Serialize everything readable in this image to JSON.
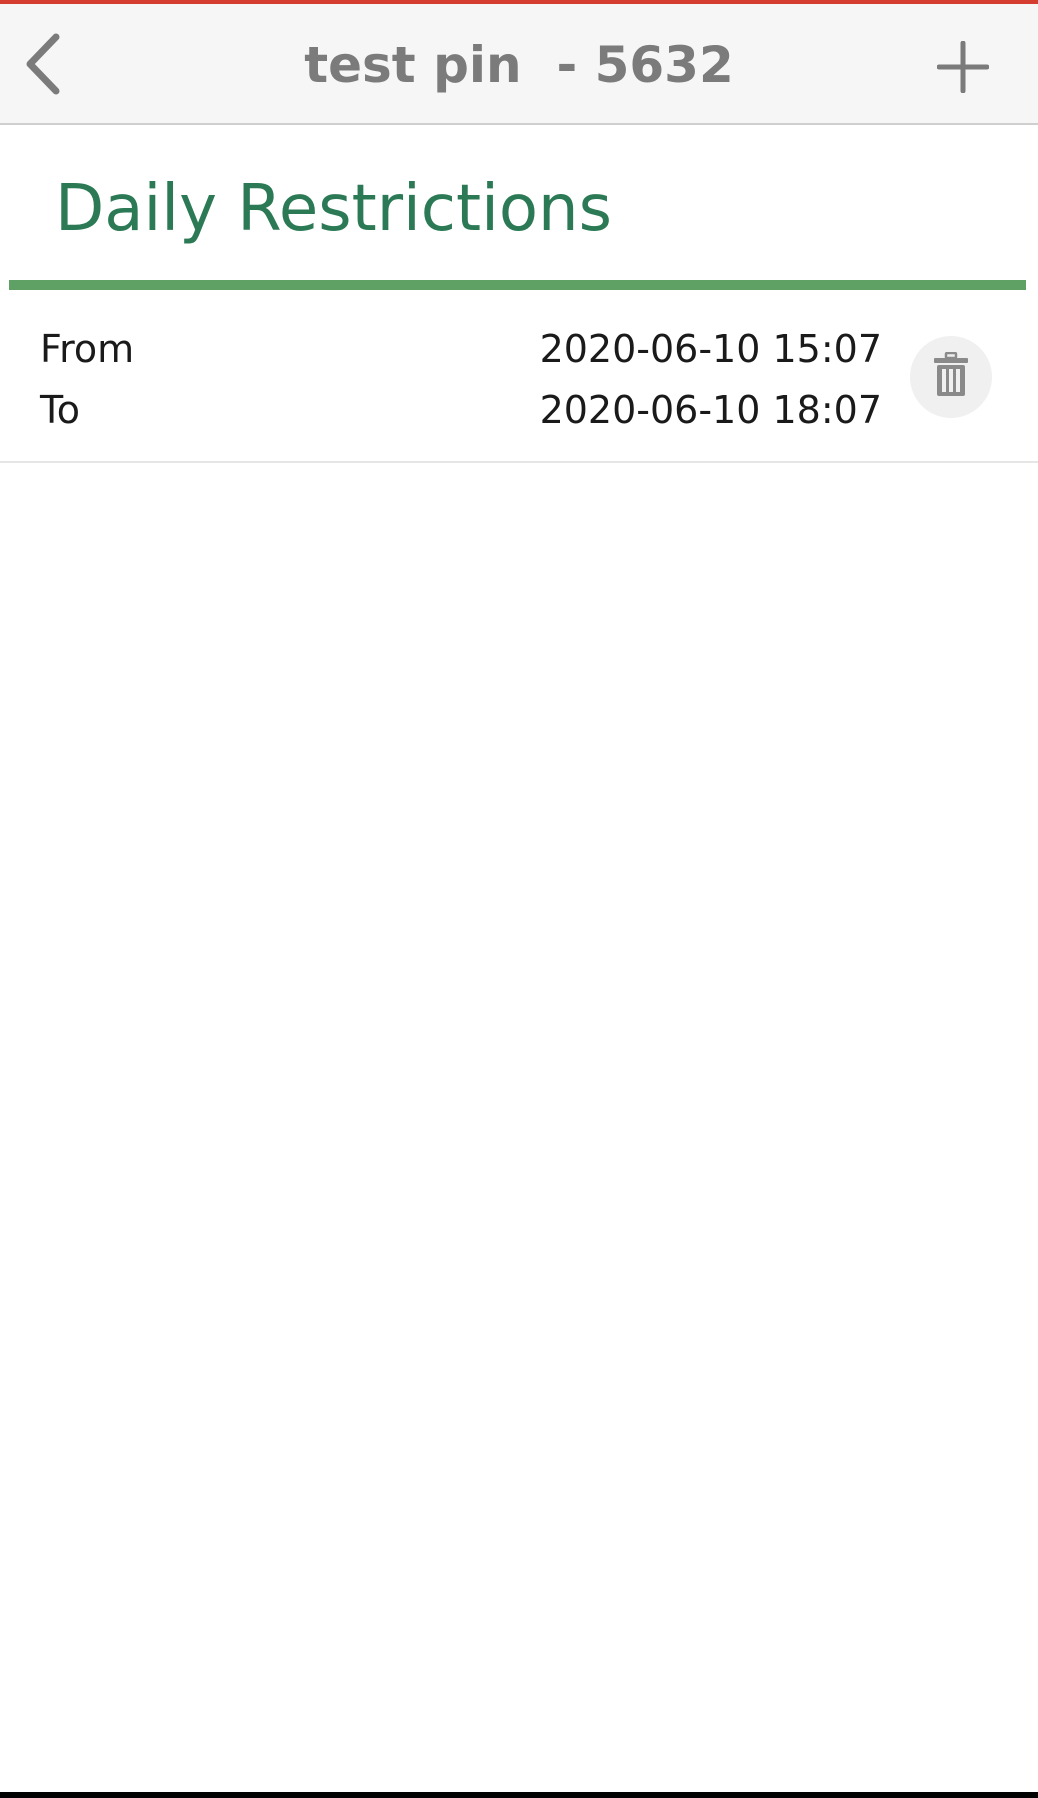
{
  "header": {
    "title": "test pin  - 5632",
    "back_icon": "chevron-left-icon",
    "add_icon": "plus-icon"
  },
  "section": {
    "title": "Daily Restrictions"
  },
  "restrictions": [
    {
      "from_label": "From",
      "from_value": "2020-06-10 15:07",
      "to_label": "To",
      "to_value": "2020-06-10 18:07",
      "delete_icon": "trash-icon"
    }
  ],
  "colors": {
    "accent_top": "#d43d2f",
    "section_title": "#2c7a55",
    "section_underline": "#5fa064",
    "header_text": "#7b7b7b"
  }
}
